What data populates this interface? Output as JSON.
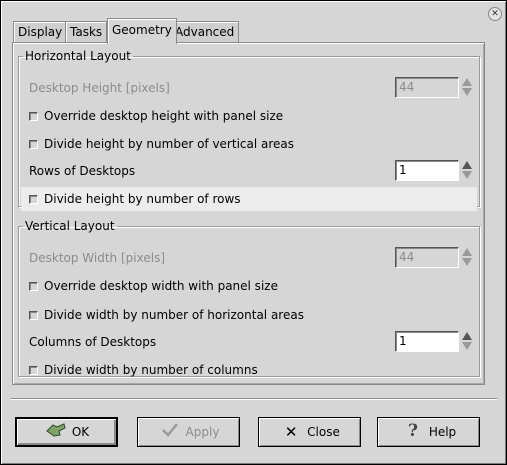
{
  "tabs": [
    {
      "label": "Display",
      "active": false
    },
    {
      "label": "Tasks",
      "active": false
    },
    {
      "label": "Geometry",
      "active": true
    },
    {
      "label": "Advanced",
      "active": false
    }
  ],
  "horizontal": {
    "title": "Horizontal Layout",
    "desktop_height_label": "Desktop Height [pixels]",
    "desktop_height_value": "44",
    "override_height_label": "Override desktop height with panel size",
    "divide_vertical_label": "Divide height by number of vertical areas",
    "rows_label": "Rows of Desktops",
    "rows_value": "1",
    "divide_rows_label": "Divide height by number of rows"
  },
  "vertical": {
    "title": "Vertical Layout",
    "desktop_width_label": "Desktop Width [pixels]",
    "desktop_width_value": "44",
    "override_width_label": "Override desktop width with panel size",
    "divide_horizontal_label": "Divide width by number of horizontal areas",
    "columns_label": "Columns of Desktops",
    "columns_value": "1",
    "divide_columns_label": "Divide width by number of columns"
  },
  "buttons": {
    "ok": "OK",
    "apply": "Apply",
    "close": "Close",
    "help": "Help"
  },
  "icons": {
    "ok": "ok-hand-icon",
    "apply": "checkmark-icon",
    "close": "x-icon",
    "help": "question-mark-icon",
    "window_close": "window-close-icon"
  }
}
